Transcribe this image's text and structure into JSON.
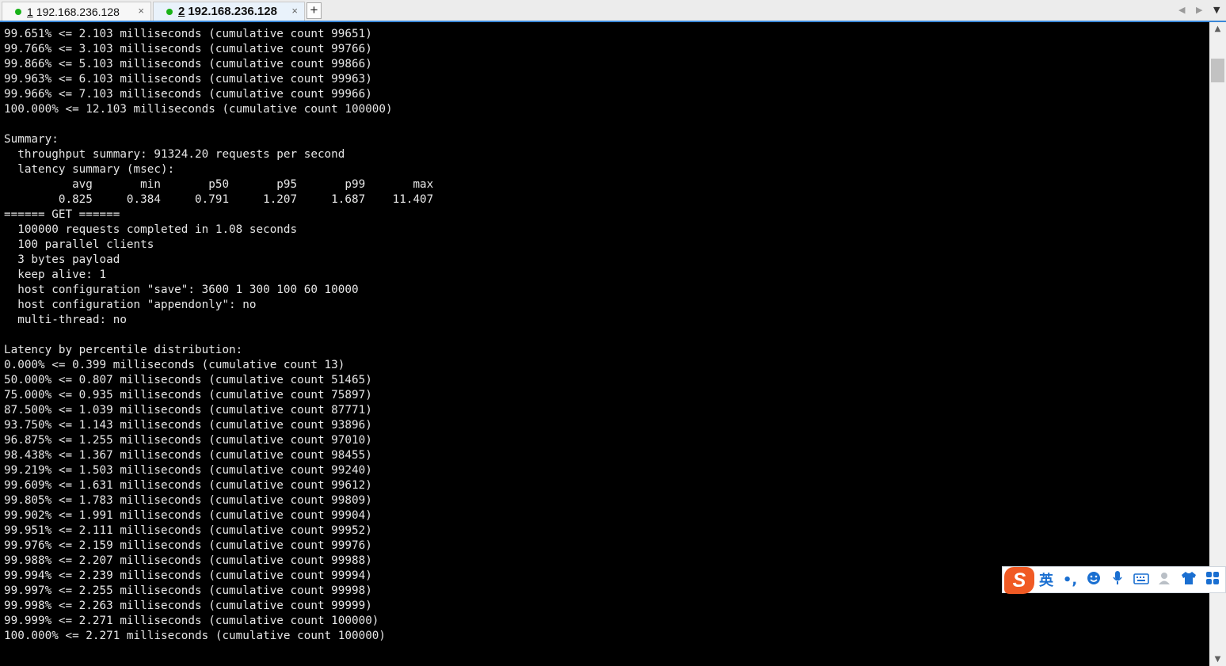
{
  "tabs": [
    {
      "num": "1",
      "title": "192.168.236.128",
      "close": "×"
    },
    {
      "num": "2",
      "title": "192.168.236.128",
      "close": "×"
    }
  ],
  "new_tab_label": "+",
  "tab_nav": {
    "prev": "◀",
    "next": "▶",
    "menu": "▼"
  },
  "status_colors": {
    "connected": "#19b219",
    "accent": "#3b88d8"
  },
  "terminal_lines": [
    "99.651% <= 2.103 milliseconds (cumulative count 99651)",
    "99.766% <= 3.103 milliseconds (cumulative count 99766)",
    "99.866% <= 5.103 milliseconds (cumulative count 99866)",
    "99.963% <= 6.103 milliseconds (cumulative count 99963)",
    "99.966% <= 7.103 milliseconds (cumulative count 99966)",
    "100.000% <= 12.103 milliseconds (cumulative count 100000)",
    "",
    "Summary:",
    "  throughput summary: 91324.20 requests per second",
    "  latency summary (msec):",
    "          avg       min       p50       p95       p99       max",
    "        0.825     0.384     0.791     1.207     1.687    11.407",
    "====== GET ======",
    "  100000 requests completed in 1.08 seconds",
    "  100 parallel clients",
    "  3 bytes payload",
    "  keep alive: 1",
    "  host configuration \"save\": 3600 1 300 100 60 10000",
    "  host configuration \"appendonly\": no",
    "  multi-thread: no",
    "",
    "Latency by percentile distribution:",
    "0.000% <= 0.399 milliseconds (cumulative count 13)",
    "50.000% <= 0.807 milliseconds (cumulative count 51465)",
    "75.000% <= 0.935 milliseconds (cumulative count 75897)",
    "87.500% <= 1.039 milliseconds (cumulative count 87771)",
    "93.750% <= 1.143 milliseconds (cumulative count 93896)",
    "96.875% <= 1.255 milliseconds (cumulative count 97010)",
    "98.438% <= 1.367 milliseconds (cumulative count 98455)",
    "99.219% <= 1.503 milliseconds (cumulative count 99240)",
    "99.609% <= 1.631 milliseconds (cumulative count 99612)",
    "99.805% <= 1.783 milliseconds (cumulative count 99809)",
    "99.902% <= 1.991 milliseconds (cumulative count 99904)",
    "99.951% <= 2.111 milliseconds (cumulative count 99952)",
    "99.976% <= 2.159 milliseconds (cumulative count 99976)",
    "99.988% <= 2.207 milliseconds (cumulative count 99988)",
    "99.994% <= 2.239 milliseconds (cumulative count 99994)",
    "99.997% <= 2.255 milliseconds (cumulative count 99998)",
    "99.998% <= 2.263 milliseconds (cumulative count 99999)",
    "99.999% <= 2.271 milliseconds (cumulative count 100000)",
    "100.000% <= 2.271 milliseconds (cumulative count 100000)"
  ],
  "scrollbar": {
    "up": "▲",
    "down": "▼"
  },
  "ime_toolbar": {
    "logo": "S",
    "language": "英",
    "punctuation": "•,",
    "icons": [
      "emoji-icon",
      "microphone-icon",
      "keyboard-icon",
      "user-icon",
      "skin-icon",
      "toolbox-icon"
    ]
  }
}
